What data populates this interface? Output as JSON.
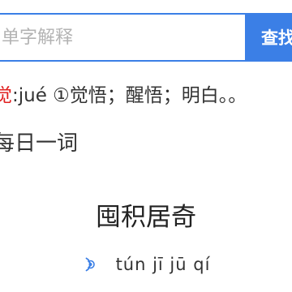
{
  "search": {
    "placeholder": "单字解释",
    "button_label": "查找"
  },
  "definition": {
    "char": "觉",
    "text": ":jué ①觉悟；醒悟；明白。。"
  },
  "daily": {
    "title": "每日一词",
    "word": "囤积居奇",
    "pinyin": "tún jī jū qí",
    "speaker_icon": "speaker-icon"
  },
  "colors": {
    "accent": "#3b7fe6",
    "highlight": "#e02020"
  }
}
